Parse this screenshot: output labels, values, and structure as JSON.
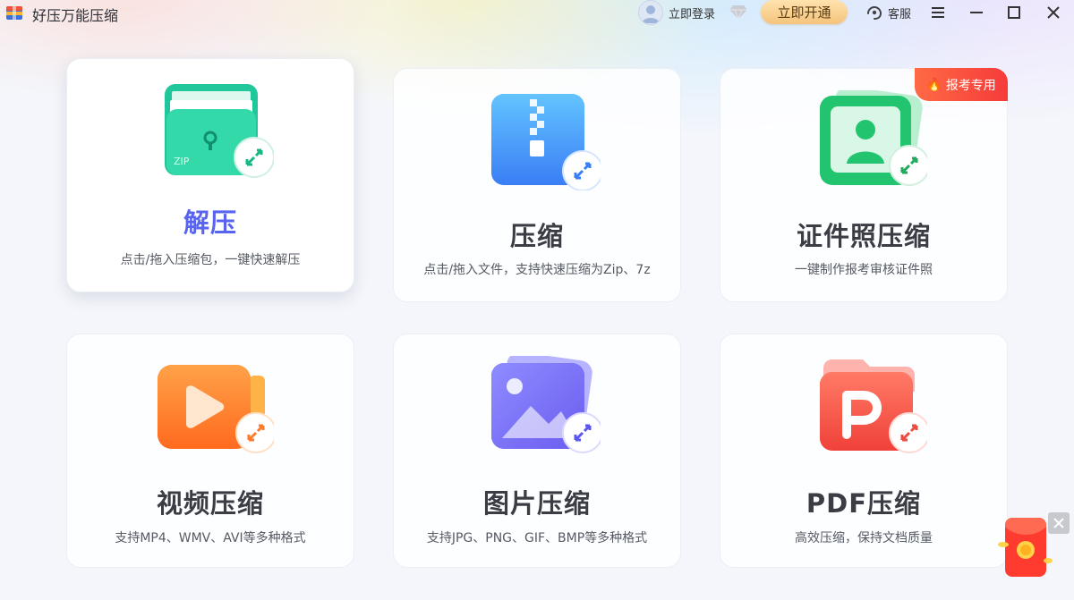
{
  "app": {
    "title": "好压万能压缩"
  },
  "header": {
    "login_label": "立即登录",
    "open_vip_label": "立即开通",
    "service_label": "客服"
  },
  "cards": [
    {
      "title": "解压",
      "desc": "点击/拖入压缩包，一键快速解压",
      "icon": "unzip-folder-icon",
      "icon_text": "ZIP",
      "active": true
    },
    {
      "title": "压缩",
      "desc": "点击/拖入文件，支持快速压缩为Zip、7z",
      "icon": "zip-archive-icon"
    },
    {
      "title": "证件照压缩",
      "desc": "一键制作报考审核证件照",
      "icon": "id-photo-icon",
      "badge": "报考专用"
    },
    {
      "title": "视频压缩",
      "desc": "支持MP4、WMV、AVI等多种格式",
      "icon": "video-icon"
    },
    {
      "title": "图片压缩",
      "desc": "支持JPG、PNG、GIF、BMP等多种格式",
      "icon": "image-icon"
    },
    {
      "title": "PDF压缩",
      "desc": "高效压缩，保持文档质量",
      "icon": "pdf-icon"
    }
  ],
  "colors": {
    "active_title": "#5863f0",
    "vip_button": "#f4c47c",
    "badge": "#f53b3b"
  }
}
